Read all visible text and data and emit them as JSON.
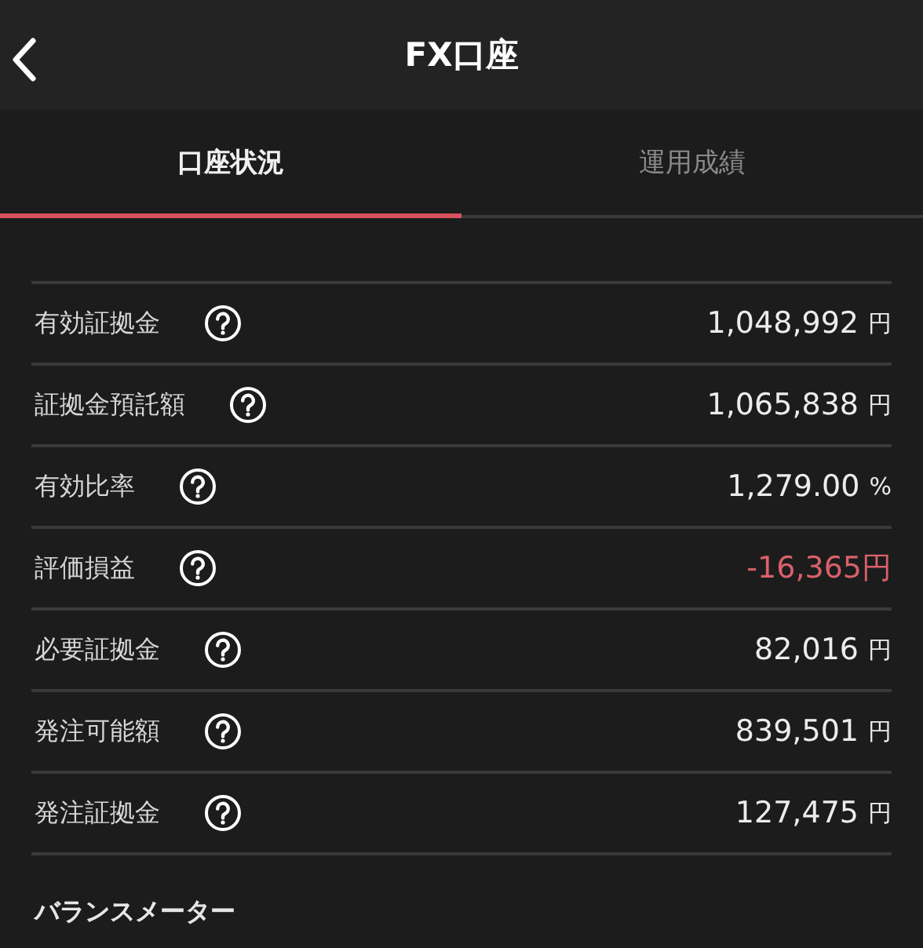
{
  "header": {
    "title": "FX口座"
  },
  "tabs": [
    {
      "label": "口座状況",
      "selected": true
    },
    {
      "label": "運用成績",
      "selected": false
    }
  ],
  "rows": [
    {
      "label": "有効証拠金",
      "value": "1,048,992",
      "unit": "円",
      "negative": false
    },
    {
      "label": "証拠金預託額",
      "value": "1,065,838",
      "unit": "円",
      "negative": false
    },
    {
      "label": "有効比率",
      "value": "1,279.00",
      "unit": "%",
      "negative": false
    },
    {
      "label": "評価損益",
      "value": "-16,365円",
      "negative": true
    },
    {
      "label": "必要証拠金",
      "value": "82,016",
      "unit": "円",
      "negative": false
    },
    {
      "label": "発注可能額",
      "value": "839,501",
      "unit": "円",
      "negative": false
    },
    {
      "label": "発注証拠金",
      "value": "127,475",
      "unit": "円",
      "negative": false
    }
  ],
  "section_heading": "バランスメーター"
}
